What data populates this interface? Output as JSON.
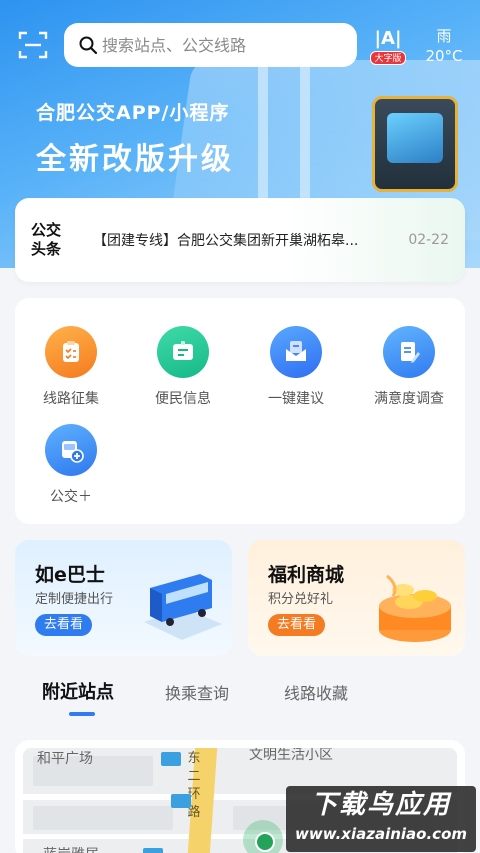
{
  "header": {
    "search_placeholder": "搜索站点、公交线路",
    "bigfont_glyph": "|A|",
    "bigfont_tag": "大字版",
    "weather": {
      "condition": "雨",
      "temperature": "20°C"
    }
  },
  "banner": {
    "subtitle": "合肥公交APP/小程序",
    "title": "全新改版升级"
  },
  "news": {
    "logo_line1": "公交",
    "logo_line2": "头条",
    "headline": "【团建专线】合肥公交集团新开巢湖柘皋...",
    "date": "02-22"
  },
  "services": [
    {
      "label": "线路征集",
      "icon": "clipboard-list-icon"
    },
    {
      "label": "便民信息",
      "icon": "message-card-icon"
    },
    {
      "label": "一键建议",
      "icon": "envelope-icon"
    },
    {
      "label": "满意度调查",
      "icon": "survey-edit-icon"
    },
    {
      "label": "公交＋",
      "icon": "bus-plus-icon"
    }
  ],
  "cards": {
    "bus": {
      "title": "如e巴士",
      "subtitle": "定制便捷出行",
      "button": "去看看"
    },
    "mall": {
      "title": "福利商城",
      "subtitle": "积分兑好礼",
      "button": "去看看"
    }
  },
  "tabs": [
    "附近站点",
    "换乘查询",
    "线路收藏"
  ],
  "map": {
    "labels": [
      "和平广场",
      "文明生活小区",
      "蓝岸雅居",
      "东二环路"
    ]
  },
  "watermark": {
    "name": "下载鸟应用",
    "url": "www.xiazainiao.com"
  },
  "colors": {
    "accent": "#2f7bf0",
    "orange": "#f47b22",
    "green": "#16b888",
    "alert": "#e8363b"
  }
}
